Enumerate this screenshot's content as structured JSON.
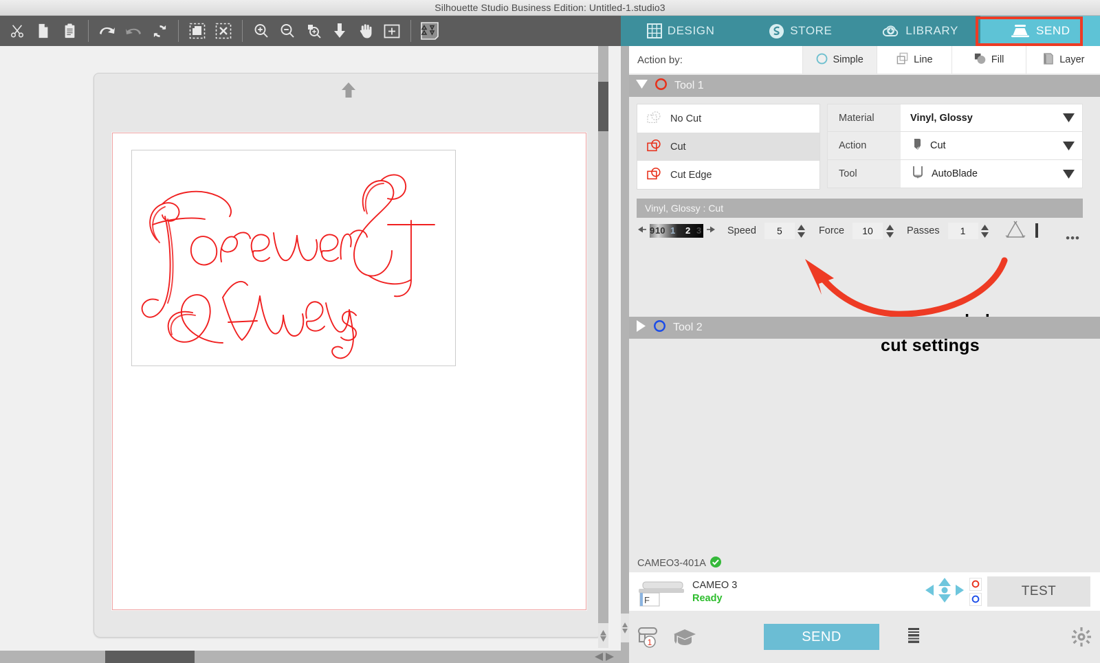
{
  "window": {
    "title": "Silhouette Studio Business Edition: Untitled-1.studio3"
  },
  "toolbar": {
    "items": [
      {
        "name": "cut-icon",
        "label": "Cut"
      },
      {
        "name": "copy-icon",
        "label": "Copy"
      },
      {
        "name": "paste-icon",
        "label": "Paste"
      },
      {
        "name": "undo-icon",
        "label": "Undo"
      },
      {
        "name": "redo-icon",
        "label": "Redo"
      },
      {
        "name": "refresh-icon",
        "label": "Refresh View"
      },
      {
        "name": "select-all-icon",
        "label": "Select All"
      },
      {
        "name": "deselect-all-icon",
        "label": "Deselect All"
      },
      {
        "name": "zoom-in-icon",
        "label": "Zoom In"
      },
      {
        "name": "zoom-out-icon",
        "label": "Zoom Out"
      },
      {
        "name": "zoom-selection-icon",
        "label": "Zoom to Selection"
      },
      {
        "name": "fit-to-page-icon",
        "label": "Fit To Window"
      },
      {
        "name": "pan-hand-icon",
        "label": "Pan"
      },
      {
        "name": "zoom-region-icon",
        "label": "Zoom Region"
      },
      {
        "name": "preview-icon",
        "label": "Preview"
      }
    ]
  },
  "nav": {
    "tabs": [
      {
        "label": "DESIGN",
        "icon": "grid-icon",
        "active": false
      },
      {
        "label": "STORE",
        "icon": "store-icon",
        "active": false
      },
      {
        "label": "LIBRARY",
        "icon": "cloud-download-icon",
        "active": false
      },
      {
        "label": "SEND",
        "icon": "cutting-machine-icon",
        "active": true
      }
    ]
  },
  "canvas": {
    "artwork_text": "Forever & Always",
    "artwork_color": "#f02020"
  },
  "panel": {
    "action_by": {
      "label": "Action by:",
      "tabs": [
        {
          "label": "Simple",
          "icon": "circle-outline-icon",
          "active": true
        },
        {
          "label": "Line",
          "icon": "line-layers-icon",
          "active": false
        },
        {
          "label": "Fill",
          "icon": "fill-shape-icon",
          "active": false
        },
        {
          "label": "Layer",
          "icon": "layer-icon",
          "active": false
        }
      ]
    },
    "tool1": {
      "title": "Tool 1",
      "expanded": true,
      "marker_color": "#e8301a",
      "options": [
        {
          "label": "No Cut",
          "icon": "no-cut-icon",
          "selected": false
        },
        {
          "label": "Cut",
          "icon": "cut-shape-icon",
          "selected": true
        },
        {
          "label": "Cut Edge",
          "icon": "cut-edge-icon",
          "selected": false
        }
      ],
      "fields": [
        {
          "name": "material",
          "label": "Material",
          "value": "Vinyl, Glossy",
          "icon": "",
          "highlight": true
        },
        {
          "name": "action",
          "label": "Action",
          "value": "Cut",
          "icon": "blade-tip-icon",
          "highlight": false
        },
        {
          "name": "tool",
          "label": "Tool",
          "value": "AutoBlade",
          "icon": "autoblade-icon",
          "highlight": true
        }
      ],
      "settings_header": "Vinyl, Glossy : Cut",
      "blade_numbers": [
        "9",
        "10",
        "1",
        "2",
        "3"
      ],
      "settings": [
        {
          "name": "speed",
          "label": "Speed",
          "value": "5"
        },
        {
          "name": "force",
          "label": "Force",
          "value": "10"
        },
        {
          "name": "passes",
          "label": "Passes",
          "value": "1"
        }
      ],
      "overcut_icon": "overcut-triangle-icon",
      "line_segment_checkbox": "",
      "more_menu": "•••"
    },
    "tool2": {
      "title": "Tool 2",
      "expanded": false,
      "marker_color": "#1a4ce8"
    },
    "annotation": {
      "line1": "recommended",
      "line2": "cut settings",
      "arrow_color": "#ee3b24",
      "box_color": "#ee3b24"
    },
    "device": {
      "id_label": "CAMEO3-401A",
      "connected_icon": "check-circle-icon",
      "name": "CAMEO 3",
      "status": "Ready",
      "status_color": "#2dbd2d",
      "dpad_icon": "dpad-icon",
      "tool_slot_1": "O",
      "tool_slot_2": "O",
      "test_button": "TEST"
    },
    "bottom": {
      "cutter_icon": "cutting-mat-icon",
      "cutter_badge": "1",
      "tutorial_icon": "graduation-cap-icon",
      "send_button": "SEND",
      "list_icon": "list-lines-icon",
      "settings_icon": "gear-icon"
    }
  }
}
